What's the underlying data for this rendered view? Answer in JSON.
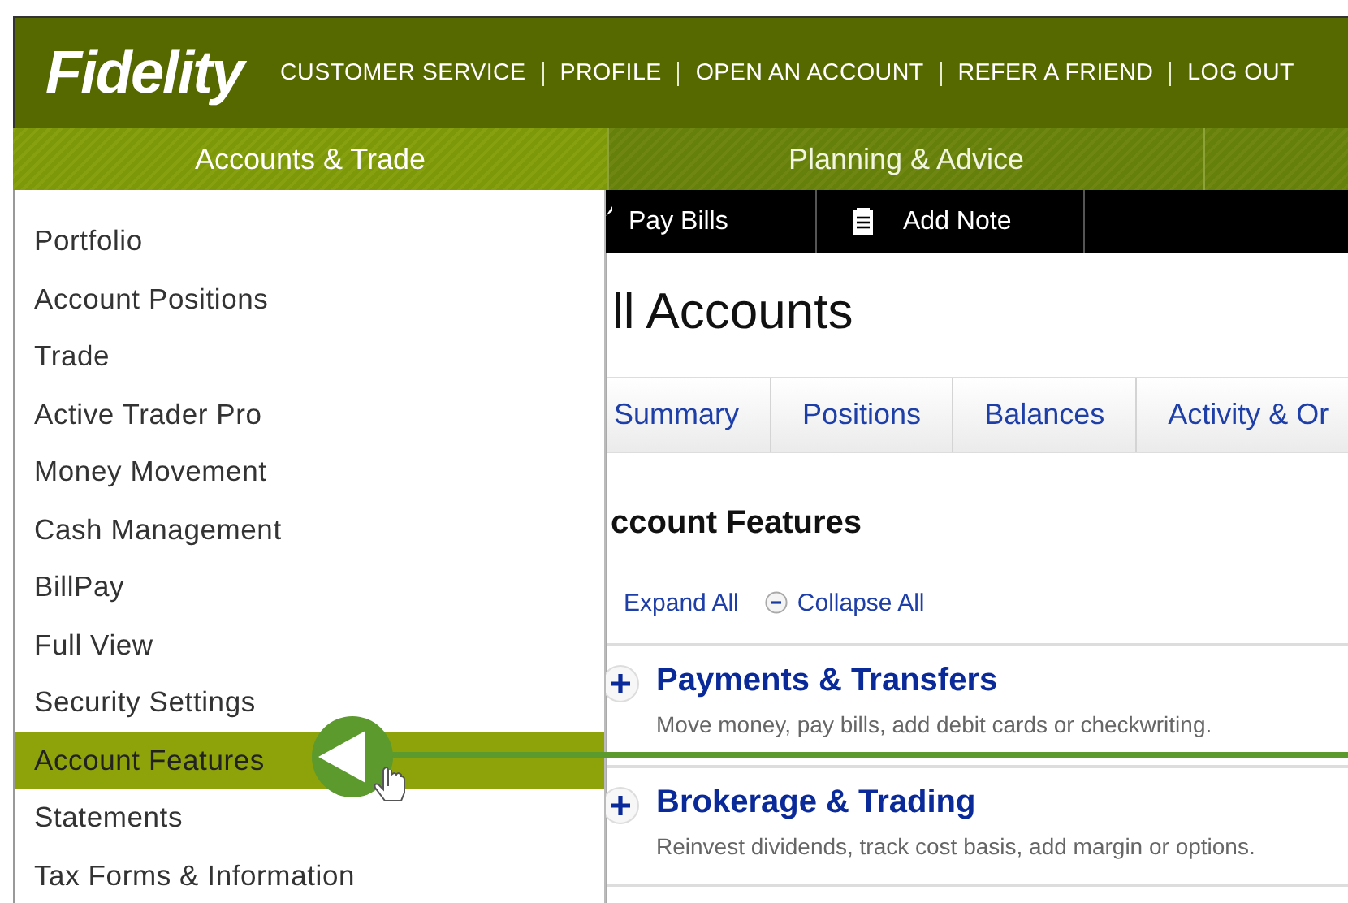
{
  "logo": "Fidelity",
  "top_links": [
    "CUSTOMER SERVICE",
    "PROFILE",
    "OPEN AN ACCOUNT",
    "REFER A FRIEND",
    "LOG OUT"
  ],
  "nav_tabs": [
    {
      "label": "Accounts & Trade",
      "selected": true
    },
    {
      "label": "Planning & Advice",
      "selected": false
    }
  ],
  "menu_items": [
    {
      "label": "Portfolio",
      "selected": false
    },
    {
      "label": "Account Positions",
      "selected": false
    },
    {
      "label": "Trade",
      "selected": false
    },
    {
      "label": "Active Trader Pro",
      "selected": false
    },
    {
      "label": "Money Movement",
      "selected": false
    },
    {
      "label": "Cash Management",
      "selected": false
    },
    {
      "label": "BillPay",
      "selected": false
    },
    {
      "label": "Full View",
      "selected": false
    },
    {
      "label": "Security Settings",
      "selected": false
    },
    {
      "label": "Account Features",
      "selected": true
    },
    {
      "label": "Statements",
      "selected": false
    },
    {
      "label": "Tax Forms & Information",
      "selected": false
    }
  ],
  "toolbar": [
    {
      "kind": "bills",
      "label": "Pay Bills"
    },
    {
      "kind": "note",
      "label": "Add Note"
    }
  ],
  "page_title": "ll Accounts",
  "account_tabs": [
    "Summary",
    "Positions",
    "Balances",
    "Activity & Or"
  ],
  "section_title": "ccount Features",
  "expand_all": "Expand All",
  "collapse_all": "Collapse All",
  "features": [
    {
      "title": "Payments & Transfers",
      "description": "Move money, pay bills, add debit cards or checkwriting."
    },
    {
      "title": "Brokerage & Trading",
      "description": "Reinvest dividends, track cost basis, add margin or options."
    }
  ]
}
